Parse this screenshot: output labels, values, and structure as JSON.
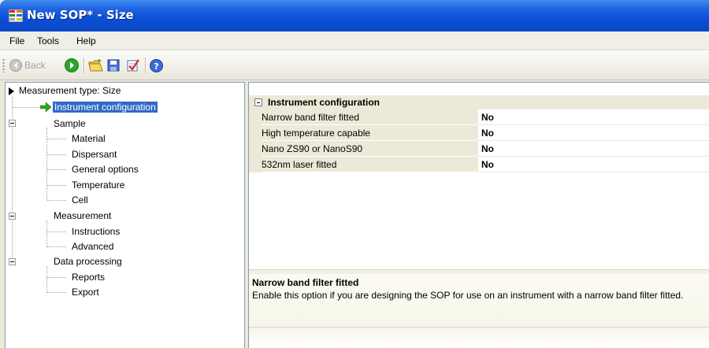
{
  "window": {
    "title": "New SOP* - Size",
    "icon": "app-grid-icon"
  },
  "menu": {
    "items": [
      {
        "label": "File"
      },
      {
        "label": "Tools"
      },
      {
        "label": "Help"
      }
    ]
  },
  "toolbar": {
    "back_label": "Back",
    "buttons": [
      "back-icon",
      "forward-icon",
      "open-icon",
      "save-icon",
      "check-icon",
      "help-icon"
    ]
  },
  "tree": {
    "root_label": "Measurement type: Size",
    "items": [
      {
        "label": "Instrument configuration"
      },
      {
        "label": "Sample"
      },
      {
        "label": "Material"
      },
      {
        "label": "Dispersant"
      },
      {
        "label": "General options"
      },
      {
        "label": "Temperature"
      },
      {
        "label": "Cell"
      },
      {
        "label": "Measurement"
      },
      {
        "label": "Instructions"
      },
      {
        "label": "Advanced"
      },
      {
        "label": "Data processing"
      },
      {
        "label": "Reports"
      },
      {
        "label": "Export"
      }
    ]
  },
  "property_grid": {
    "category": "Instrument configuration",
    "rows": [
      {
        "name": "Narrow band filter fitted",
        "value": "No"
      },
      {
        "name": "High temperature capable",
        "value": "No"
      },
      {
        "name": "Nano ZS90 or NanoS90",
        "value": "No"
      },
      {
        "name": "532nm laser fitted",
        "value": "No"
      }
    ]
  },
  "help": {
    "title": "Narrow band filter fitted",
    "text": "Enable this option if you are designing the SOP for use on an instrument with a narrow band filter fitted."
  },
  "colors": {
    "title_bar": "#0b4fd6",
    "selection": "#316ac5",
    "grid_background": "#ece9d8"
  }
}
